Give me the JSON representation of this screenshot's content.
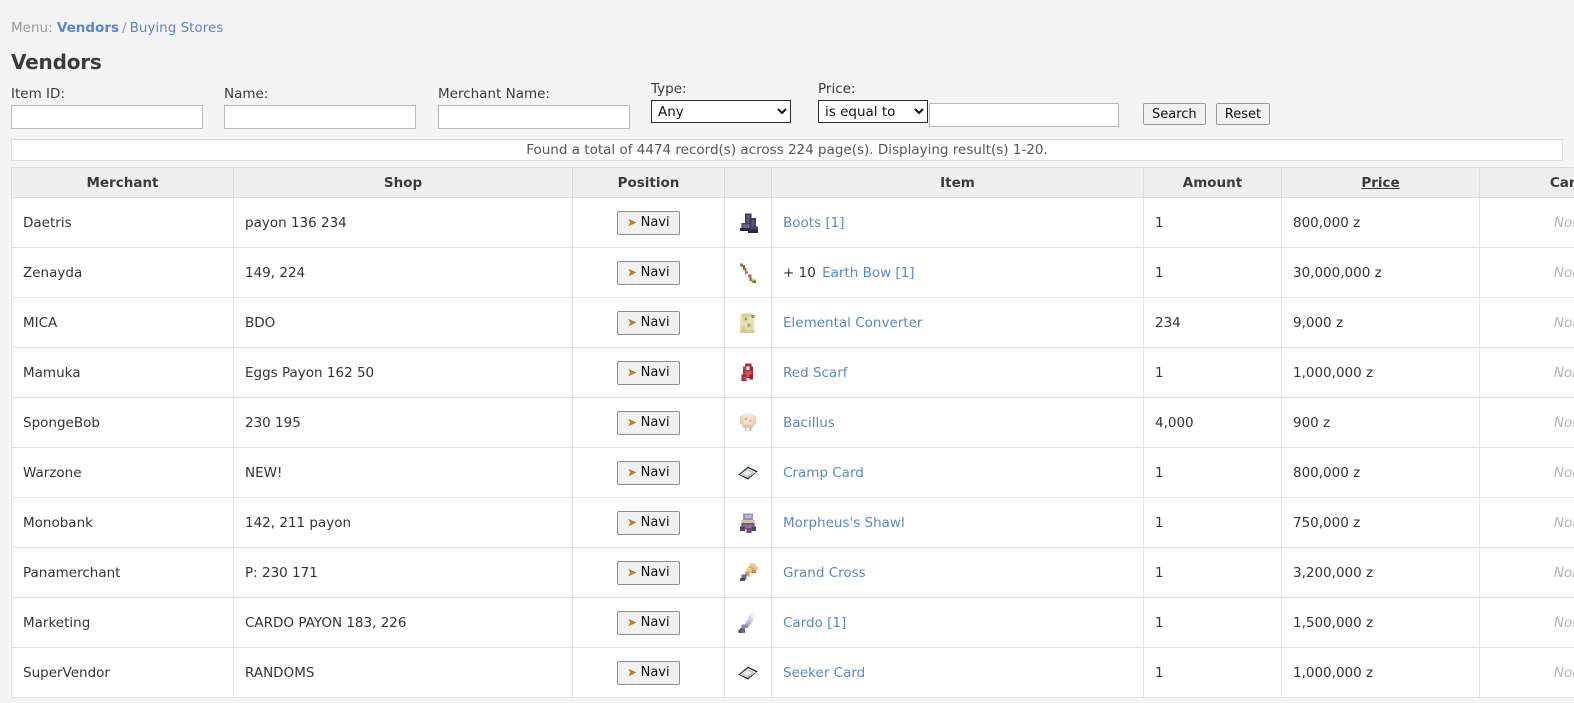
{
  "breadcrumb": {
    "menu_label": "Menu:",
    "separator": "/",
    "link1": "Vendors",
    "link2": "Buying Stores"
  },
  "page_title": "Vendors",
  "filters": {
    "item_id": {
      "label": "Item ID:",
      "value": "",
      "placeholder": ""
    },
    "name": {
      "label": "Name:",
      "value": "",
      "placeholder": ""
    },
    "merchant_name": {
      "label": "Merchant Name:",
      "value": "",
      "placeholder": ""
    },
    "type": {
      "label": "Type:",
      "selected": "Any",
      "options": [
        "Any"
      ]
    },
    "price": {
      "label": "Price:",
      "selected": "is equal to",
      "options": [
        "is equal to"
      ],
      "value": "",
      "placeholder": ""
    },
    "search_button": "Search",
    "reset_button": "Reset"
  },
  "notice": "Found a total of 4474 record(s) across 224 page(s). Displaying result(s) 1-20.",
  "table": {
    "columns": [
      {
        "key": "merchant",
        "label": "Merchant",
        "sorted": false
      },
      {
        "key": "shop",
        "label": "Shop",
        "sorted": false
      },
      {
        "key": "position",
        "label": "Position",
        "sorted": false
      },
      {
        "key": "icon",
        "label": "",
        "sorted": false
      },
      {
        "key": "item",
        "label": "Item",
        "sorted": false
      },
      {
        "key": "amount",
        "label": "Amount",
        "sorted": false
      },
      {
        "key": "price",
        "label": "Price",
        "sorted": true
      },
      {
        "key": "cards",
        "label": "Cards",
        "sorted": false
      }
    ],
    "navi_label": "Navi",
    "navi_glyph": "➤",
    "none_label": "None",
    "rows": [
      {
        "merchant": "Daetris",
        "shop": "payon 136 234",
        "icon": "boots-icon",
        "refine": "",
        "item": "Boots [1]",
        "amount": "1",
        "price": "800,000 z",
        "cards": "None"
      },
      {
        "merchant": "Zenayda",
        "shop": "149, 224",
        "icon": "bow-icon",
        "refine": "+ 10",
        "item": "Earth Bow [1]",
        "amount": "1",
        "price": "30,000,000 z",
        "cards": "None"
      },
      {
        "merchant": "MICA",
        "shop": "BDO",
        "icon": "scroll-icon",
        "refine": "",
        "item": "Elemental Converter",
        "amount": "234",
        "price": "9,000 z",
        "cards": "None"
      },
      {
        "merchant": "Mamuka",
        "shop": "Eggs Payon 162 50",
        "icon": "scarf-icon",
        "refine": "",
        "item": "Red Scarf",
        "amount": "1",
        "price": "1,000,000 z",
        "cards": "None"
      },
      {
        "merchant": "SpongeBob",
        "shop": "230 195",
        "icon": "bacillus-icon",
        "refine": "",
        "item": "Bacillus",
        "amount": "4,000",
        "price": "900 z",
        "cards": "None"
      },
      {
        "merchant": "Warzone",
        "shop": "NEW!",
        "icon": "card-icon",
        "refine": "",
        "item": "Cramp Card",
        "amount": "1",
        "price": "800,000 z",
        "cards": "None"
      },
      {
        "merchant": "Monobank",
        "shop": "142, 211 payon",
        "icon": "shawl-icon",
        "refine": "",
        "item": "Morpheus's Shawl",
        "amount": "1",
        "price": "750,000 z",
        "cards": "None"
      },
      {
        "merchant": "Panamerchant",
        "shop": "P: 230 171",
        "icon": "grand-cross-icon",
        "refine": "",
        "item": "Grand Cross",
        "amount": "1",
        "price": "3,200,000 z",
        "cards": "None"
      },
      {
        "merchant": "Marketing",
        "shop": "CARDO PAYON 183, 226",
        "icon": "cardo-icon",
        "refine": "",
        "item": "Cardo [1]",
        "amount": "1",
        "price": "1,500,000 z",
        "cards": "None"
      },
      {
        "merchant": "SuperVendor",
        "shop": "RANDOMS",
        "icon": "card-icon",
        "refine": "",
        "item": "Seeker Card",
        "amount": "1",
        "price": "1,000,000 z",
        "cards": "None"
      }
    ]
  },
  "colors": {
    "link": "#5b87c5",
    "header_bg": "#efefef",
    "page_bg": "#f4f4f4",
    "muted": "#999999",
    "navi_arrow": "#c87a1e"
  }
}
